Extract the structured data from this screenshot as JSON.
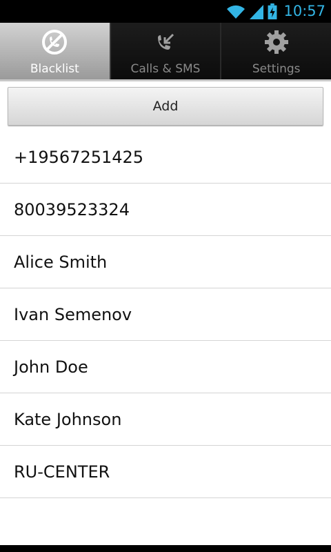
{
  "status_bar": {
    "time": "10:57",
    "icons": [
      "wifi-icon",
      "signal-icon",
      "battery-charging-icon"
    ],
    "accent_color": "#33b5e5"
  },
  "tabs": [
    {
      "label": "Blacklist",
      "icon": "blocked-call-icon",
      "active": true
    },
    {
      "label": "Calls & SMS",
      "icon": "incoming-call-icon",
      "active": false
    },
    {
      "label": "Settings",
      "icon": "gear-icon",
      "active": false
    }
  ],
  "add_button": {
    "label": "Add"
  },
  "blacklist": [
    {
      "name": "+19567251425"
    },
    {
      "name": "80039523324"
    },
    {
      "name": "Alice Smith"
    },
    {
      "name": "Ivan Semenov"
    },
    {
      "name": "John Doe"
    },
    {
      "name": "Kate Johnson"
    },
    {
      "name": "RU-CENTER"
    }
  ]
}
